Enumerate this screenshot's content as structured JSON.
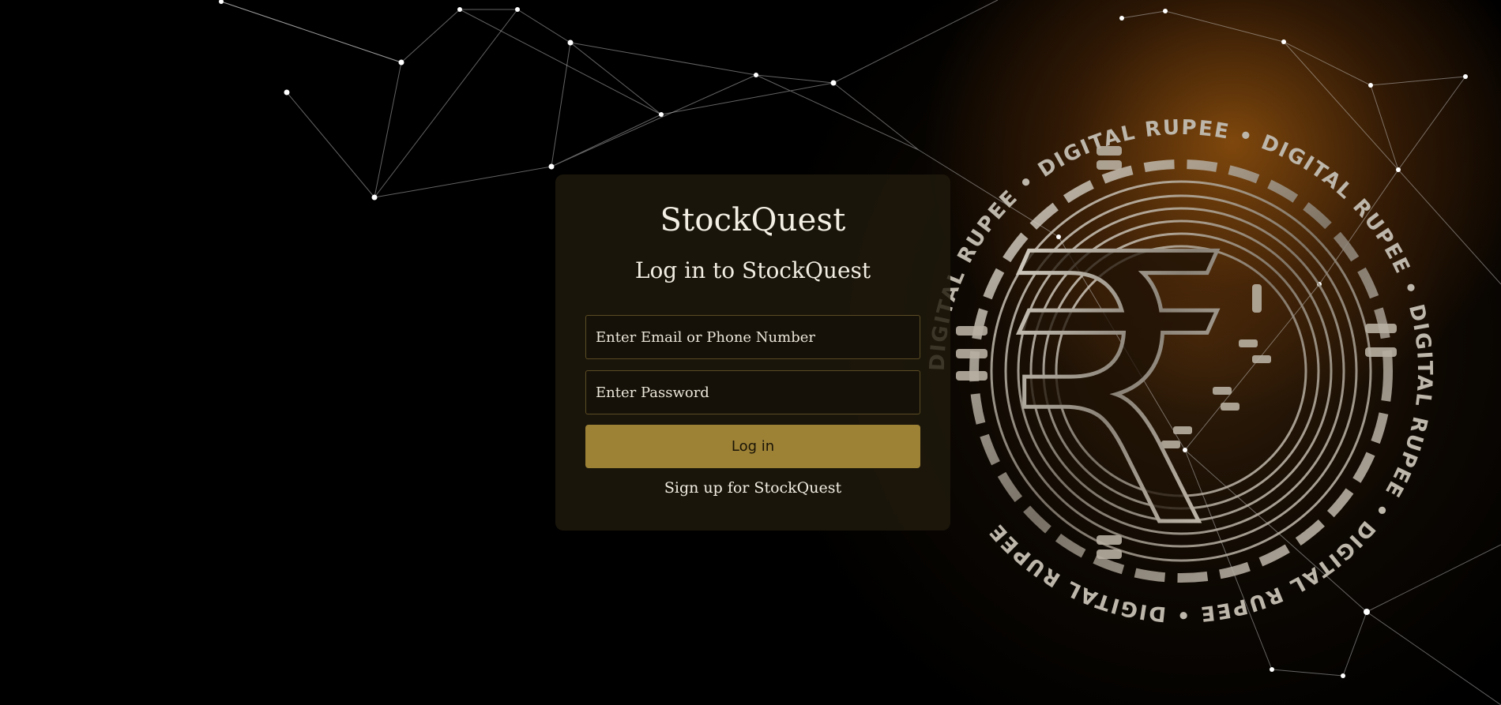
{
  "background": {
    "coin_ring_text": "DIGITAL RUPEE",
    "coin_symbol": "₹",
    "accent_glow": "#d67814"
  },
  "card": {
    "brand": "StockQuest",
    "heading": "Log in to StockQuest",
    "email_placeholder": "Enter Email or Phone Number",
    "password_placeholder": "Enter Password",
    "login_label": "Log in",
    "signup_label": "Sign up for StockQuest",
    "button_color": "#9d8236"
  }
}
